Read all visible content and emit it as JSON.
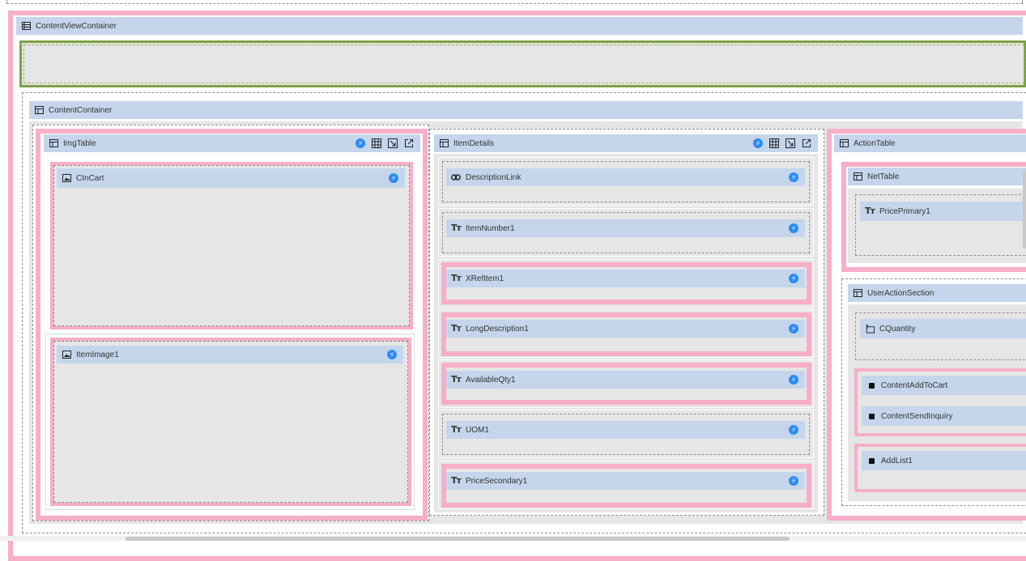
{
  "containers": {
    "content_view_container": "ContentViewContainer",
    "content_container": "ContentContainer",
    "img_table": "ImgTable",
    "item_details": "ItemDetails",
    "action_table": "ActionTable",
    "net_table": "NetTable",
    "user_action_section": "UserActionSection"
  },
  "components": {
    "cin_cart": "CInCart",
    "item_image": "ItemImage1",
    "description_link": "DescriptionLink",
    "item_number": "ItemNumber1",
    "xref_item": "XRefItem1",
    "long_description": "LongDescription1",
    "available_qty": "AvailableQty1",
    "uom": "UOM1",
    "price_secondary": "PriceSecondary1",
    "price_primary": "PricePrimary1",
    "c_quantity": "CQuantity",
    "content_add_to_cart": "ContentAddToCart",
    "content_send_inquiry": "ContentSendInquiry",
    "add_list": "AddList1"
  },
  "colors": {
    "header": "#c5d6ec",
    "selected_border": "#f7aec9",
    "drop_zone_border": "#7da244",
    "body": "#e6e6e6",
    "action_icon": "#2b8cf3"
  },
  "icons": {
    "list": "list-icon",
    "table": "table-icon",
    "image": "image-icon",
    "link": "link-icon",
    "text": "text-icon",
    "input": "input-icon",
    "button": "button-icon",
    "action": "lightning-icon",
    "grid": "grid-icon",
    "resize": "resize-icon",
    "open": "open-external-icon"
  }
}
